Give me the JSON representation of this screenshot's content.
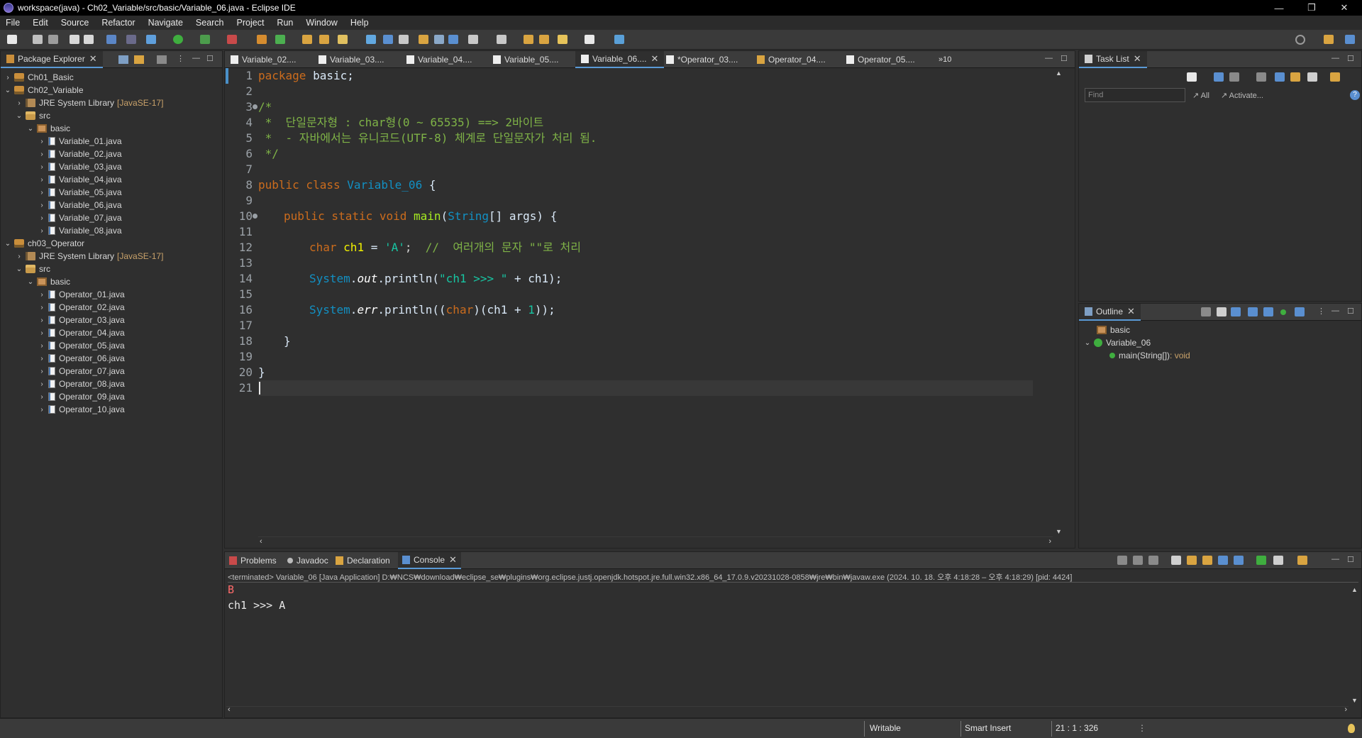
{
  "window": {
    "title": "workspace(java) - Ch02_Variable/src/basic/Variable_06.java - Eclipse IDE",
    "controls": {
      "minimize": "—",
      "restore": "❐",
      "close": "✕"
    }
  },
  "menu": [
    "File",
    "Edit",
    "Source",
    "Refactor",
    "Navigate",
    "Search",
    "Project",
    "Run",
    "Window",
    "Help"
  ],
  "package_explorer": {
    "title": "Package Explorer",
    "items": [
      {
        "label": "Ch01_Basic",
        "icon": "project-icon",
        "expanded": false
      },
      {
        "label": "Ch02_Variable",
        "icon": "project-icon",
        "expanded": true
      },
      {
        "label": "JRE System Library",
        "decoration": "[JavaSE-17]",
        "icon": "library-icon",
        "expanded": false
      },
      {
        "label": "src",
        "icon": "source-folder-icon",
        "expanded": true
      },
      {
        "label": "basic",
        "icon": "package-icon",
        "expanded": true
      },
      {
        "label": "Variable_01.java",
        "icon": "java-file-icon"
      },
      {
        "label": "Variable_02.java",
        "icon": "java-file-icon"
      },
      {
        "label": "Variable_03.java",
        "icon": "java-file-icon"
      },
      {
        "label": "Variable_04.java",
        "icon": "java-file-icon"
      },
      {
        "label": "Variable_05.java",
        "icon": "java-file-icon"
      },
      {
        "label": "Variable_06.java",
        "icon": "java-file-icon"
      },
      {
        "label": "Variable_07.java",
        "icon": "java-file-icon"
      },
      {
        "label": "Variable_08.java",
        "icon": "java-file-icon"
      },
      {
        "label": "ch03_Operator",
        "icon": "project-icon",
        "expanded": true
      },
      {
        "label": "JRE System Library",
        "decoration": "[JavaSE-17]",
        "icon": "library-icon",
        "expanded": false
      },
      {
        "label": "src",
        "icon": "source-folder-icon",
        "expanded": true
      },
      {
        "label": "basic",
        "icon": "package-icon",
        "expanded": true
      },
      {
        "label": "Operator_01.java",
        "icon": "java-file-icon"
      },
      {
        "label": "Operator_02.java",
        "icon": "java-file-icon"
      },
      {
        "label": "Operator_03.java",
        "icon": "java-file-icon"
      },
      {
        "label": "Operator_04.java",
        "icon": "java-file-icon"
      },
      {
        "label": "Operator_05.java",
        "icon": "java-file-icon"
      },
      {
        "label": "Operator_06.java",
        "icon": "java-file-icon"
      },
      {
        "label": "Operator_07.java",
        "icon": "java-file-icon"
      },
      {
        "label": "Operator_08.java",
        "icon": "java-file-icon"
      },
      {
        "label": "Operator_09.java",
        "icon": "java-file-icon"
      },
      {
        "label": "Operator_10.java",
        "icon": "java-file-icon"
      }
    ]
  },
  "editor": {
    "tabs": [
      "Variable_02....",
      "Variable_03....",
      "Variable_04....",
      "Variable_05....",
      "Variable_06....",
      "*Operator_03....",
      "Operator_04....",
      "Operator_05...."
    ],
    "active_tab": "Variable_06....",
    "overflow": "»10",
    "line_numbers": [
      "1",
      "2",
      "3",
      "4",
      "5",
      "6",
      "7",
      "8",
      "9",
      "10",
      "11",
      "12",
      "13",
      "14",
      "15",
      "16",
      "17",
      "18",
      "19",
      "20",
      "21"
    ],
    "code": {
      "l1_kw": "package",
      "l1_rest": " basic;",
      "l3": "/*",
      "l4": " *  단일문자형 : char형(0 ~ 65535) ==> 2바이트",
      "l5": " *  - 자바에서는 유니코드(UTF-8) 체계로 단일문자가 처리 됨.",
      "l6": " */",
      "l8_kw": "public class",
      "l8_cls": "Variable_06",
      "l8_rest": " {",
      "l10_kw": "public static void",
      "l10_m": "main",
      "l10_p": "(",
      "l10_type": "String",
      "l10_args": "[] args) {",
      "l12_kw": "char",
      "l12_var": "ch1",
      "l12_eq": " = ",
      "l12_str": "'A'",
      "l12_cm": "//  여러개의 문자 \"\"로 처리",
      "l14_cls": "System",
      "l14_dot": ".",
      "l14_fld": "out",
      "l14_call": ".println(",
      "l14_str": "\"ch1 >>> \"",
      "l14_rest": " + ch1);",
      "l16_cls": "System",
      "l16_dot": ".",
      "l16_fld": "err",
      "l16_call": ".println((",
      "l16_kw": "char",
      "l16_rest": ")(ch1 + ",
      "l16_num": "1",
      "l16_end": "));",
      "l18": "}",
      "l20": "}"
    }
  },
  "task_list": {
    "title": "Task List",
    "find_placeholder": "Find",
    "all_label": "All",
    "activate_label": "Activate..."
  },
  "outline": {
    "title": "Outline",
    "items": [
      {
        "label": "basic",
        "icon": "package-icon"
      },
      {
        "label": "Variable_06",
        "icon": "class-icon"
      },
      {
        "label": "main(String[])",
        "type": " : void",
        "icon": "method-icon"
      }
    ]
  },
  "bottom_panel": {
    "tabs": [
      "Problems",
      "Javadoc",
      "Declaration",
      "Console"
    ],
    "active_tab": "Console",
    "console_header": "<terminated> Variable_06 [Java Application] D:₩NCS₩download₩eclipse_se₩plugins₩org.eclipse.justj.openjdk.hotspot.jre.full.win32.x86_64_17.0.9.v20231028-0858₩jre₩bin₩javaw.exe  (2024. 10. 18. 오후 4:18:28 – 오후 4:18:29) [pid: 4424]",
    "stderr_line": "B",
    "stdout_line": "ch1 >>> A"
  },
  "status": {
    "mode": "Writable",
    "insert": "Smart Insert",
    "position": "21 : 1 : 326"
  },
  "colors": {
    "keyword": "#cc6c1d",
    "comment": "#7fb347",
    "class": "#1290c3",
    "string": "#17c6a3",
    "variable": "#f2f200",
    "stderr": "#ff6b6b",
    "accent": "#5a9ad6"
  }
}
